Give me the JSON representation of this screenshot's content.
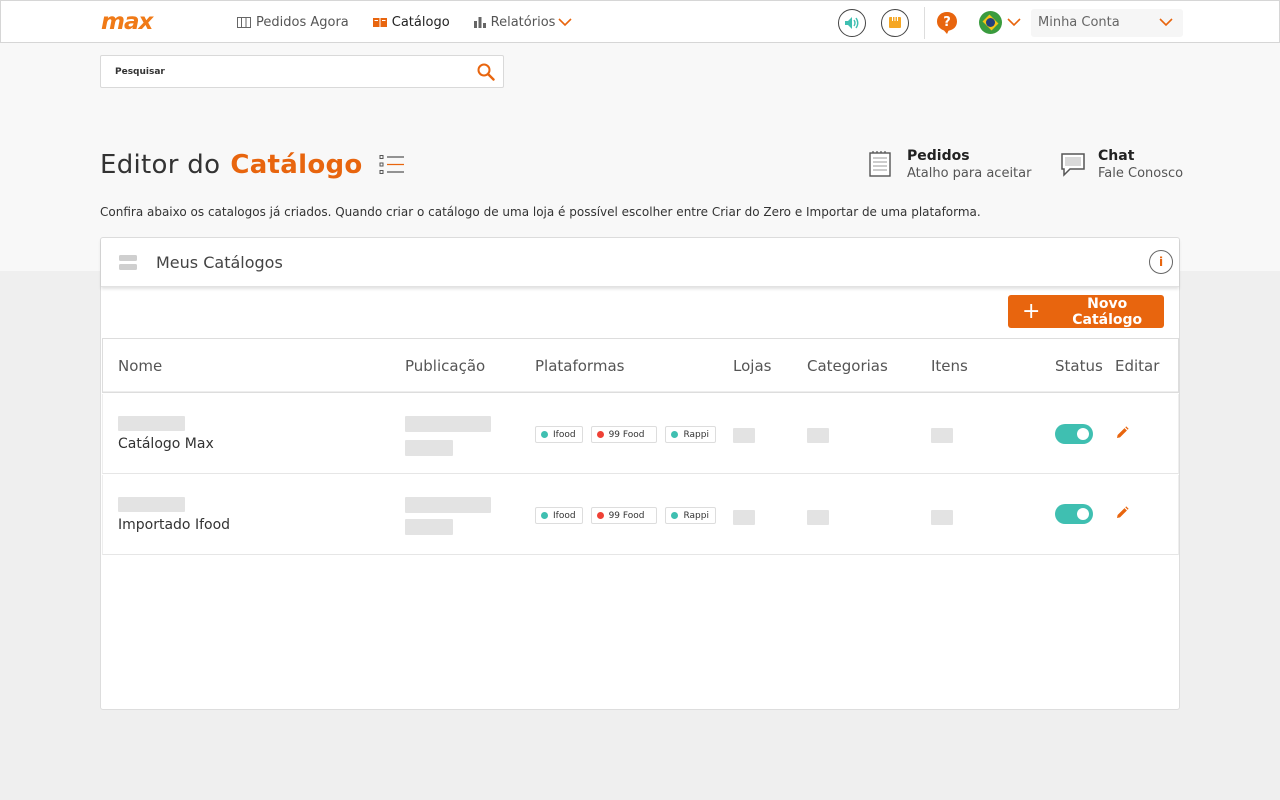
{
  "brand": {
    "logo_text": "max",
    "accent_color": "#e8650e"
  },
  "nav": {
    "items": [
      {
        "label": "Pedidos Agora",
        "icon": "columns-icon"
      },
      {
        "label": "Catálogo",
        "icon": "book-icon",
        "active": true
      },
      {
        "label": "Relatórios",
        "icon": "bar-chart-icon"
      }
    ]
  },
  "topbar": {
    "account_label": "Minha Conta"
  },
  "search": {
    "placeholder": "Pesquisar"
  },
  "header": {
    "title_prefix": "Editor do",
    "title_accent": "Catálogo",
    "description": "Confira abaixo os catalogos já criados. Quando criar o catálogo de uma loja é possível escolher entre Criar do Zero e Importar de uma plataforma."
  },
  "shortcuts": {
    "orders": {
      "title": "Pedidos",
      "subtitle": "Atalho para aceitar"
    },
    "chat": {
      "title": "Chat",
      "subtitle": "Fale Conosco"
    }
  },
  "catalogs": {
    "title": "Meus Catálogos",
    "info_label": "i",
    "new_button": "Novo Catálogo",
    "columns": [
      "Nome",
      "Publicação",
      "Plataformas",
      "Lojas",
      "Categorias",
      "Itens",
      "Status",
      "Editar"
    ],
    "rows": [
      {
        "name": "Catálogo Max",
        "platforms": [
          {
            "label": "Ifood",
            "color": "#3fbfb1"
          },
          {
            "label": "99 Food",
            "color": "#ef4136"
          },
          {
            "label": "Rappi",
            "color": "#3fbfb1"
          }
        ],
        "status": true
      },
      {
        "name": "Importado Ifood",
        "platforms": [
          {
            "label": "Ifood",
            "color": "#3fbfb1"
          },
          {
            "label": "99 Food",
            "color": "#ef4136"
          },
          {
            "label": "Rappi",
            "color": "#3fbfb1"
          }
        ],
        "status": true
      }
    ]
  }
}
